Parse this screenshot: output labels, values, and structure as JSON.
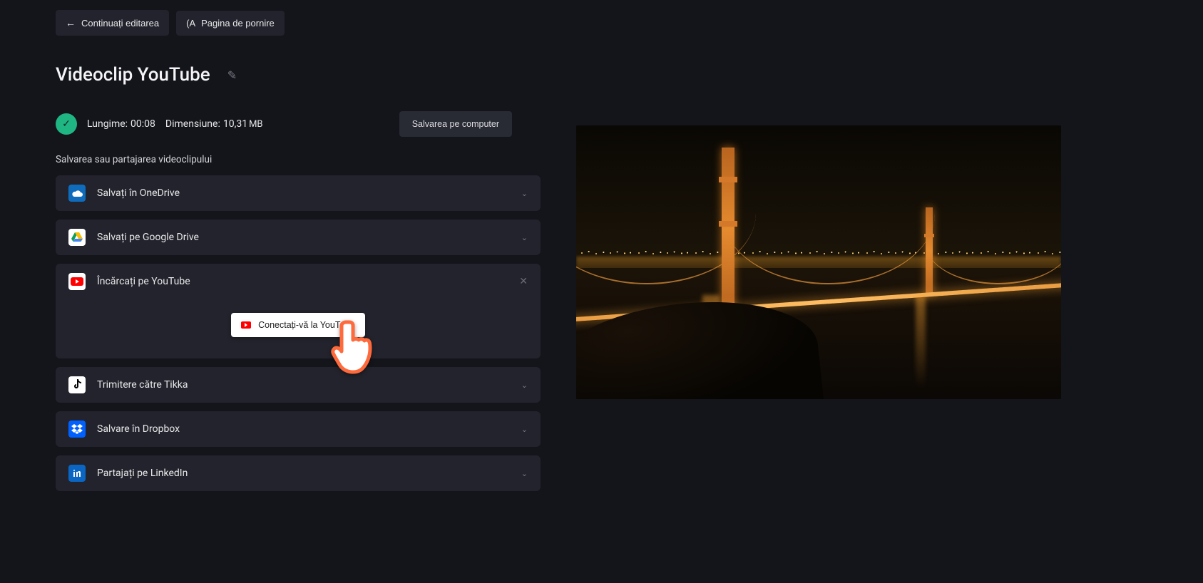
{
  "top": {
    "continue_label": "Continuați editarea",
    "home_prefix": "(A",
    "home_label": "Pagina de pornire"
  },
  "page": {
    "title": "Videoclip YouTube"
  },
  "meta": {
    "length_label": "Lungime:",
    "length_value": "00:08",
    "size_label": "Dimensiune:",
    "size_value": "10,31",
    "size_unit": "MB",
    "save_computer_label": "Salvarea pe computer"
  },
  "share": {
    "section_label": "Salvarea sau partajarea videoclipului",
    "items": [
      {
        "id": "onedrive",
        "label": "Salvați în OneDrive"
      },
      {
        "id": "gdrive",
        "label": "Salvați pe Google Drive"
      },
      {
        "id": "youtube",
        "label": "Încărcați pe YouTube",
        "expanded": true,
        "connect_label": "Conectați-vă la YouTube"
      },
      {
        "id": "tiktok",
        "label": "Trimitere către Tikka"
      },
      {
        "id": "dropbox",
        "label": "Salvare în Dropbox"
      },
      {
        "id": "linkedin",
        "label": "Partajați pe LinkedIn"
      }
    ]
  },
  "icons": {
    "back": "←",
    "pencil": "✎",
    "check": "✓",
    "chevron_down": "⌄",
    "close": "✕"
  }
}
